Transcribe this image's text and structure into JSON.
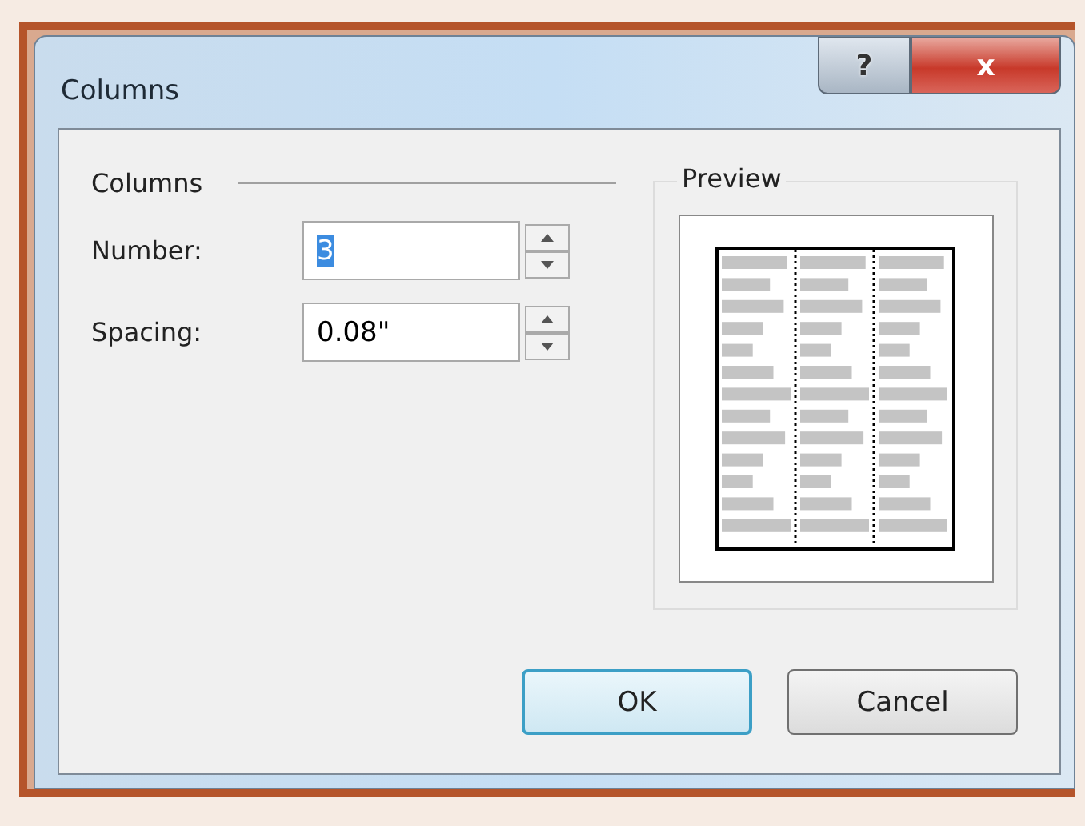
{
  "window": {
    "title": "Columns",
    "title_buttons": [
      {
        "kind": "help",
        "label": "?"
      },
      {
        "kind": "close",
        "label": "x"
      }
    ]
  },
  "columns_group": {
    "title": "Columns",
    "fields": [
      {
        "label": "Number:",
        "value": "3",
        "text_selected": true
      },
      {
        "label": "Spacing:",
        "value": "0.08\"",
        "text_selected": false
      }
    ]
  },
  "preview": {
    "title": "Preview"
  },
  "buttons": [
    {
      "label": "OK",
      "default": true
    },
    {
      "label": "Cancel",
      "default": false
    }
  ]
}
